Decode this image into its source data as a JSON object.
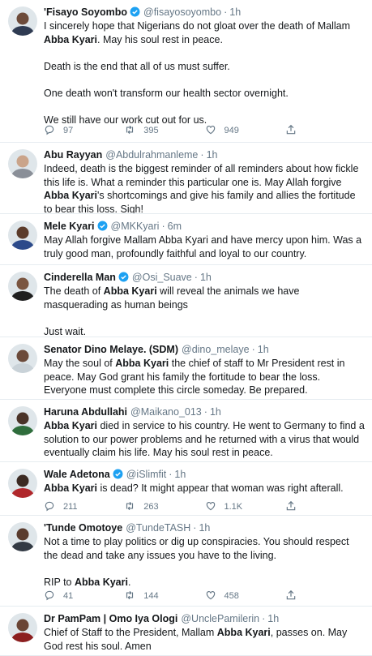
{
  "colors": {
    "verified": "#1da1f2",
    "muted": "#657786",
    "border": "#e6ecf0"
  },
  "tweets": [
    {
      "name": "'Fisayo Soyombo",
      "verified": true,
      "handle": "@fisayosoyombo",
      "sep": "·",
      "time": "1h",
      "paragraphs": [
        [
          {
            "t": "I sincerely hope that Nigerians do not gloat over the death of Mallam "
          },
          {
            "t": "Abba Kyari",
            "b": true
          },
          {
            "t": ". May his soul rest in peace."
          }
        ],
        [
          {
            "t": "Death is the end that all of us must suffer."
          }
        ],
        [
          {
            "t": "One death won't transform our health sector overnight."
          }
        ],
        [
          {
            "t": "We still have our work cut out for us."
          }
        ]
      ],
      "actions": {
        "replies": "97",
        "retweets": "395",
        "likes": "949"
      }
    },
    {
      "name": "Abu Rayyan",
      "verified": false,
      "handle": "@Abdulrahmanleme",
      "sep": "·",
      "time": "1h",
      "paragraphs": [
        [
          {
            "t": "Indeed, death is the biggest reminder of all reminders about how fickle this life is. What a reminder this particular one is. May Allah forgive "
          },
          {
            "t": "Abba Kyari",
            "b": true
          },
          {
            "t": "'s shortcomings and give his family and allies the fortitude to bear this loss. Sigh!"
          }
        ]
      ]
    },
    {
      "name": "Mele Kyari",
      "verified": true,
      "handle": "@MKKyari",
      "sep": "·",
      "time": "6m",
      "paragraphs": [
        [
          {
            "t": "May Allah forgive Mallam Abba Kyari and have mercy upon him. Was a truly good man, profoundly faithful and loyal to our country."
          }
        ]
      ]
    },
    {
      "name": "Cinderella Man",
      "verified": true,
      "handle": "@Osi_Suave",
      "sep": "·",
      "time": "1h",
      "paragraphs": [
        [
          {
            "t": "The death of "
          },
          {
            "t": "Abba Kyari",
            "b": true
          },
          {
            "t": " will reveal the animals we have masquerading as human beings"
          }
        ],
        [
          {
            "t": "Just wait."
          }
        ]
      ]
    },
    {
      "name": "Senator Dino Melaye. (SDM)",
      "verified": false,
      "handle": "@dino_melaye",
      "sep": "·",
      "time": "1h",
      "paragraphs": [
        [
          {
            "t": "May the soul of "
          },
          {
            "t": "Abba Kyari",
            "b": true
          },
          {
            "t": " the chief of staff to Mr President rest in peace. May God grant his family the fortitude to bear the loss. Everyone must complete this circle someday. Be prepared."
          }
        ]
      ]
    },
    {
      "name": "Haruna Abdullahi",
      "verified": false,
      "handle": "@Maikano_013",
      "sep": "·",
      "time": "1h",
      "paragraphs": [
        [
          {
            "t": "Abba Kyari",
            "b": true
          },
          {
            "t": " died in service to his country. He went to Germany to find a solution to our power problems and he returned with a virus that would eventually claim his life. May his soul rest in peace."
          }
        ]
      ]
    },
    {
      "name": "Wale Adetona",
      "verified": true,
      "handle": "@iSlimfit",
      "sep": "·",
      "time": "1h",
      "paragraphs": [
        [
          {
            "t": "Abba Kyari",
            "b": true
          },
          {
            "t": " is dead? It might appear that woman was right afterall."
          }
        ]
      ],
      "actions": {
        "replies": "211",
        "retweets": "263",
        "likes": "1.1K"
      }
    },
    {
      "name": "'Tunde Omotoye",
      "verified": false,
      "handle": "@TundeTASH",
      "sep": "·",
      "time": "1h",
      "paragraphs": [
        [
          {
            "t": "Not a time to play politics or dig up conspiracies. You should respect the dead and take any issues you have to the living."
          }
        ],
        [
          {
            "t": "RIP to "
          },
          {
            "t": "Abba Kyari",
            "b": true
          },
          {
            "t": "."
          }
        ]
      ],
      "actions": {
        "replies": "41",
        "retweets": "144",
        "likes": "458"
      }
    },
    {
      "name": "Dr PamPam | Omo Iya Ologi",
      "verified": false,
      "handle": "@UnclePamilerin",
      "sep": "·",
      "time": "1h",
      "paragraphs": [
        [
          {
            "t": "Chief of Staff to the President, Mallam "
          },
          {
            "t": "Abba Kyari",
            "b": true
          },
          {
            "t": ", passes on. May God rest his soul. Amen"
          }
        ]
      ]
    }
  ]
}
